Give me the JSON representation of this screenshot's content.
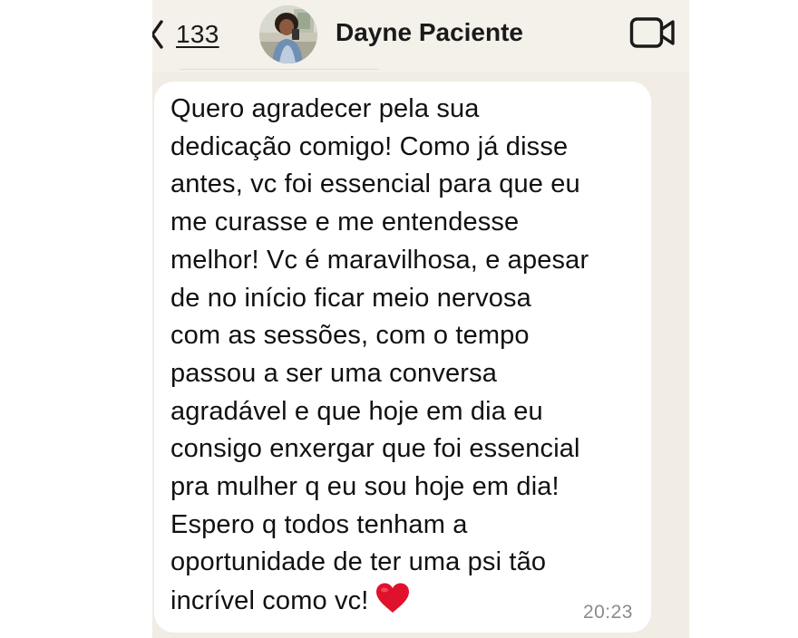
{
  "header": {
    "back_count": "133",
    "contact_name": "Dayne Paciente",
    "avatar_icon": "contact-avatar-photo",
    "video_icon": "video-camera-icon"
  },
  "message": {
    "text": "Quero agradecer pela sua\ndedicação comigo! Como já disse\nantes, vc foi essencial para que eu\nme curasse e me entendesse\nmelhor! Vc é maravilhosa, e apesar\nde no início ficar meio nervosa\ncom as sessões, com o tempo\npassou a ser uma conversa\nagradável e que hoje em dia eu\nconsigo enxergar que foi essencial\npra mulher q eu sou hoje em dia!\nEspero q todos tenham a\noportunidade de ter uma psi tão\nincrível como vc!",
    "emoji": "heart-icon",
    "time": "20:23"
  },
  "colors": {
    "background": "#f1ece4",
    "bubble": "#ffffff",
    "heart": "#e0112b",
    "timestamp": "#8b8b8b"
  }
}
